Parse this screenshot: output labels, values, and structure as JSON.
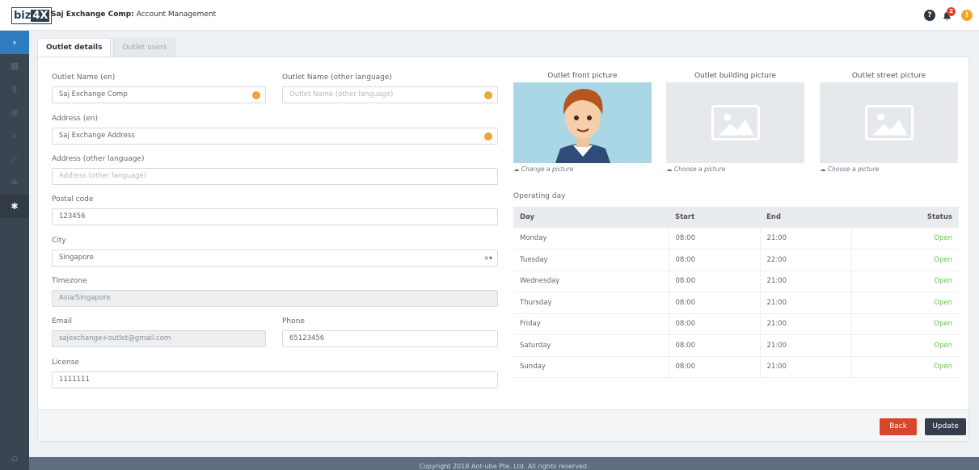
{
  "header": {
    "logo_text": "biz",
    "logo_accent": "4X",
    "company": "Saj Exchange Comp:",
    "page_title": "Account Management",
    "notification_count": "2"
  },
  "sidebar": {
    "items": [
      "dashboard-icon",
      "dollar-icon",
      "currency-icon",
      "search-icon",
      "chart-icon",
      "users-icon",
      "gear-icon"
    ]
  },
  "tabs": [
    {
      "label": "Outlet details",
      "active": true
    },
    {
      "label": "Outlet users",
      "active": false
    }
  ],
  "form": {
    "outlet_name_en": {
      "label": "Outlet Name (en)",
      "value": "Saj Exchange Comp"
    },
    "outlet_name_other": {
      "label": "Outlet Name (other language)",
      "placeholder": "Outlet Name (other language)"
    },
    "address_en": {
      "label": "Address (en)",
      "value": "Saj Exchange Address"
    },
    "address_other": {
      "label": "Address (other language)",
      "placeholder": "Address (other language)"
    },
    "postal_code": {
      "label": "Postal code",
      "value": "123456"
    },
    "city": {
      "label": "City",
      "value": "Singapore",
      "clear": "×▾"
    },
    "timezone": {
      "label": "Timezone",
      "value": "Asia/Singapore"
    },
    "email": {
      "label": "Email",
      "value": "sajexchange+outlet@gmail.com"
    },
    "phone": {
      "label": "Phone",
      "value": "65123456"
    },
    "license": {
      "label": "License",
      "value": "1111111"
    }
  },
  "pictures": [
    {
      "title": "Outlet front picture",
      "link": "Change a picture"
    },
    {
      "title": "Outlet building picture",
      "link": "Choose a picture"
    },
    {
      "title": "Outlet street picture",
      "link": "Choose a picture"
    }
  ],
  "operating": {
    "label": "Operating day",
    "headers": [
      "Day",
      "Start",
      "End",
      "Status"
    ],
    "rows": [
      [
        "Monday",
        "08:00",
        "21:00",
        "Open"
      ],
      [
        "Tuesday",
        "08:00",
        "22:00",
        "Open"
      ],
      [
        "Wednesday",
        "08:00",
        "21:00",
        "Open"
      ],
      [
        "Thursday",
        "08:00",
        "21:00",
        "Open"
      ],
      [
        "Friday",
        "08:00",
        "21:00",
        "Open"
      ],
      [
        "Saturday",
        "08:00",
        "21:00",
        "Open"
      ],
      [
        "Sunday",
        "08:00",
        "21:00",
        "Open"
      ]
    ]
  },
  "buttons": {
    "back": "Back",
    "update": "Update"
  },
  "footer": {
    "copyright": "Copyright 2018 Ant-ube Pte. Ltd. All rights reserved."
  },
  "colors": {
    "accent_dark": "#343f4b",
    "danger": "#d9472b",
    "required_dot": "#f0a53b",
    "open_status": "#6cbf4b"
  }
}
